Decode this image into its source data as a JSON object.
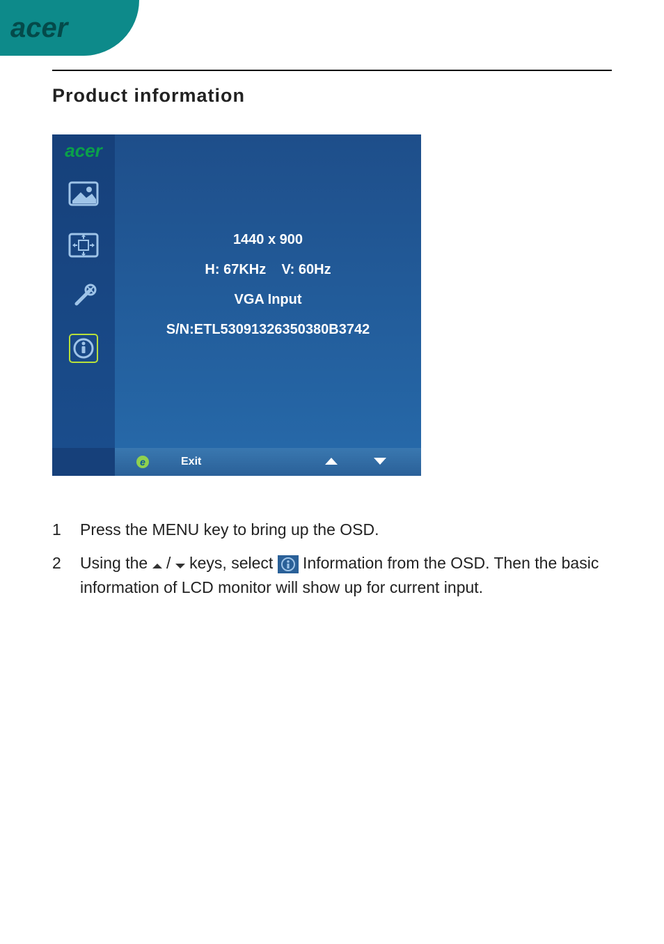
{
  "header": {
    "brand": "acer"
  },
  "page": {
    "title": "Product information"
  },
  "osd": {
    "brand": "acer",
    "info": {
      "resolution": "1440 x 900",
      "hfreq_label": "H: 67KHz",
      "vfreq_label": "V: 60Hz",
      "input": "VGA Input",
      "serial": "S/N:ETL53091326350380B3742"
    },
    "footer": {
      "exit": "Exit"
    }
  },
  "steps": [
    {
      "num": "1",
      "text_a": "Press the MENU key to bring up the OSD."
    },
    {
      "num": "2",
      "text_a": "Using the ",
      "text_b": " / ",
      "text_c": " keys, select ",
      "text_d": " Information from the OSD. Then the basic information of LCD monitor will show up for current input."
    }
  ]
}
